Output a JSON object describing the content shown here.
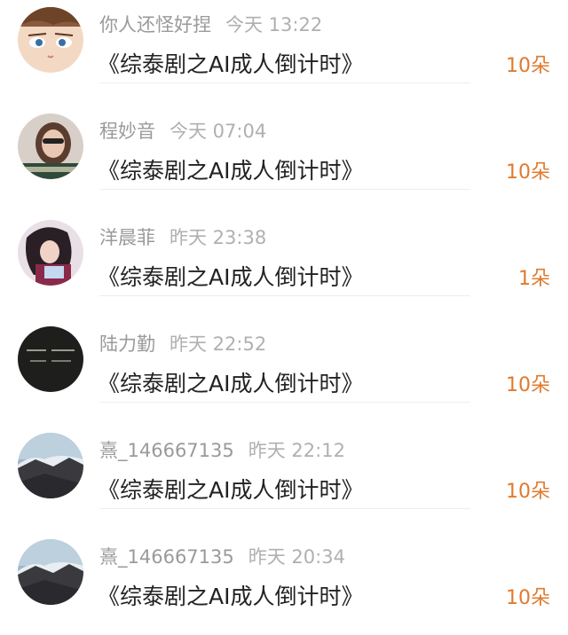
{
  "items": [
    {
      "name": "你人还怪好捏",
      "time": "今天 13:22",
      "title": "《综泰剧之AI成人倒计时》",
      "amount": "10朵"
    },
    {
      "name": "程妙音",
      "time": "今天 07:04",
      "title": "《综泰剧之AI成人倒计时》",
      "amount": "10朵"
    },
    {
      "name": "洋晨菲",
      "time": "昨天 23:38",
      "title": "《综泰剧之AI成人倒计时》",
      "amount": "1朵"
    },
    {
      "name": "陆力勤",
      "time": "昨天 22:52",
      "title": "《综泰剧之AI成人倒计时》",
      "amount": "10朵"
    },
    {
      "name": "熹_146667135",
      "time": "昨天 22:12",
      "title": "《综泰剧之AI成人倒计时》",
      "amount": "10朵"
    },
    {
      "name": "熹_146667135",
      "time": "昨天 20:34",
      "title": "《综泰剧之AI成人倒计时》",
      "amount": "10朵"
    }
  ],
  "colors": {
    "amount": "#e07a2e",
    "name": "#9a9a9a",
    "title": "#222222"
  }
}
